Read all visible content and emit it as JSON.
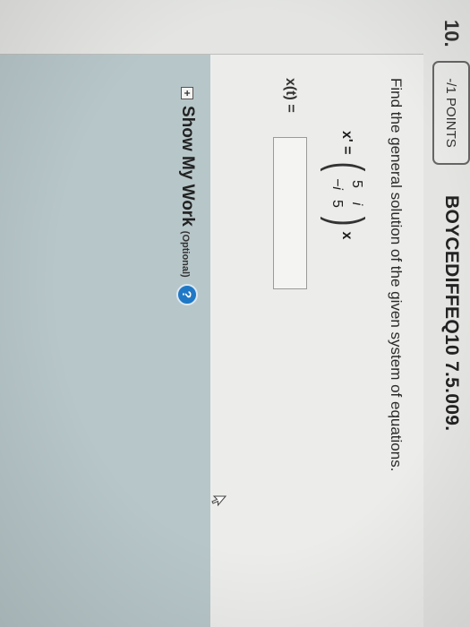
{
  "question": {
    "number": "10.",
    "points": "-/1 POINTS",
    "id": "BOYCEDIFFEQ10 7.5.009."
  },
  "problem": {
    "prompt": "Find the general solution of the given system of equations.",
    "equation": {
      "lhs": "x' =",
      "matrix": [
        [
          "5",
          "i"
        ],
        [
          "−i",
          "5"
        ]
      ],
      "rhs": "x"
    },
    "answer_label": "x(t) ="
  },
  "show_work": {
    "toggle_symbol": "+",
    "title": "Show My Work",
    "optional": "(Optional)",
    "help_symbol": "?"
  },
  "colors": {
    "show_work_panel": "#b7c6c9",
    "help_icon": "#1f78c5"
  },
  "icons": {
    "cursor": "mouse-pointer-icon",
    "help": "question-circle-icon",
    "expand": "plus-box-icon"
  }
}
